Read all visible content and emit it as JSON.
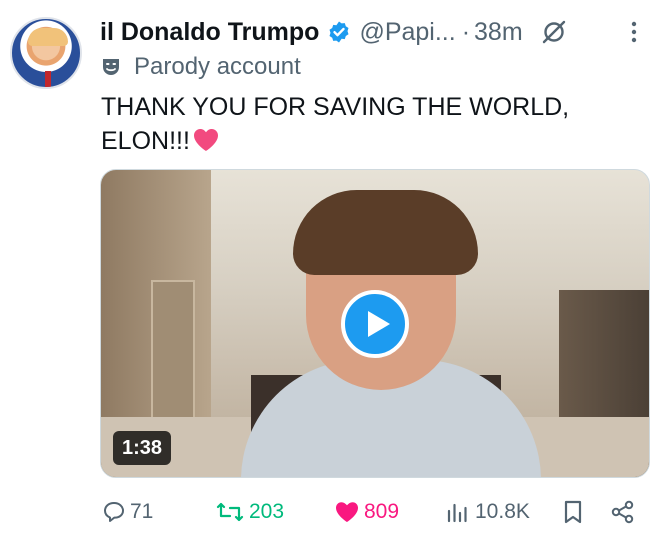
{
  "author": {
    "name": "il Donaldo Trumpo",
    "handle": "@Papi...",
    "separator": "·",
    "time": "38m",
    "label": "Parody account"
  },
  "post": {
    "text_line1": "THANK YOU FOR SAVING THE WORLD,",
    "text_line2": "ELON!!!"
  },
  "media": {
    "type": "video",
    "duration": "1:38"
  },
  "actions": {
    "replies": "71",
    "reposts": "203",
    "likes": "809",
    "views": "10.8K"
  },
  "icons": [
    "verified-badge-icon",
    "grok-icon",
    "more-icon",
    "parody-mask-icon",
    "heart-emoji-icon",
    "play-icon",
    "reply-icon",
    "repost-icon",
    "like-icon",
    "views-icon",
    "bookmark-icon",
    "share-icon"
  ],
  "colors": {
    "accent": "#1d9bf0",
    "secondary_text": "#536471",
    "repost_green": "#00ba7c",
    "like_pink": "#f91880"
  }
}
